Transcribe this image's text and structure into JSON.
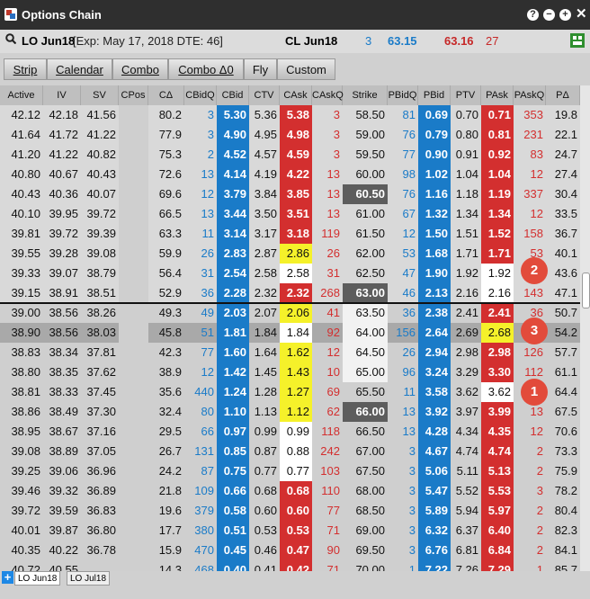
{
  "window": {
    "title": "Options Chain",
    "controls": [
      "?",
      "−",
      "+",
      "✕"
    ]
  },
  "info": {
    "symbol": "LO Jun18",
    "expiry": "[Exp: May 17, 2018 DTE: 46]",
    "underlying": "CL Jun18",
    "bid_size": "3",
    "bid": "63.15",
    "ask": "63.16",
    "ask_size": "27"
  },
  "tabs": [
    "Strip",
    "Calendar",
    "Combo",
    "Combo Δ0",
    "Fly",
    "Custom"
  ],
  "columns": [
    "Active",
    "IV",
    "SV",
    "CPos",
    "CΔ",
    "CBidQ",
    "CBid",
    "CTV",
    "CAsk",
    "CAskQ",
    "Strike",
    "PBidQ",
    "PBid",
    "PTV",
    "PAsk",
    "PAskQ",
    "PΔ"
  ],
  "rows": [
    [
      "42.12",
      "42.18",
      "41.56",
      "",
      "80.2",
      "3",
      "5.30",
      "5.36",
      "5.38",
      "3",
      "58.50",
      "81",
      "0.69",
      "0.70",
      "0.71",
      "353",
      "19.8"
    ],
    [
      "41.64",
      "41.72",
      "41.22",
      "",
      "77.9",
      "3",
      "4.90",
      "4.95",
      "4.98",
      "3",
      "59.00",
      "76",
      "0.79",
      "0.80",
      "0.81",
      "231",
      "22.1"
    ],
    [
      "41.20",
      "41.22",
      "40.82",
      "",
      "75.3",
      "2",
      "4.52",
      "4.57",
      "4.59",
      "3",
      "59.50",
      "77",
      "0.90",
      "0.91",
      "0.92",
      "83",
      "24.7"
    ],
    [
      "40.80",
      "40.67",
      "40.43",
      "",
      "72.6",
      "13",
      "4.14",
      "4.19",
      "4.22",
      "13",
      "60.00",
      "98",
      "1.02",
      "1.04",
      "1.04",
      "12",
      "27.4"
    ],
    [
      "40.43",
      "40.36",
      "40.07",
      "",
      "69.6",
      "12",
      "3.79",
      "3.84",
      "3.85",
      "13",
      "60.50",
      "76",
      "1.16",
      "1.18",
      "1.19",
      "337",
      "30.4"
    ],
    [
      "40.10",
      "39.95",
      "39.72",
      "",
      "66.5",
      "13",
      "3.44",
      "3.50",
      "3.51",
      "13",
      "61.00",
      "67",
      "1.32",
      "1.34",
      "1.34",
      "12",
      "33.5"
    ],
    [
      "39.81",
      "39.72",
      "39.39",
      "",
      "63.3",
      "11",
      "3.14",
      "3.17",
      "3.18",
      "119",
      "61.50",
      "12",
      "1.50",
      "1.51",
      "1.52",
      "158",
      "36.7"
    ],
    [
      "39.55",
      "39.28",
      "39.08",
      "",
      "59.9",
      "26",
      "2.83",
      "2.87",
      "2.86",
      "26",
      "62.00",
      "53",
      "1.68",
      "1.71",
      "1.71",
      "53",
      "40.1"
    ],
    [
      "39.33",
      "39.07",
      "38.79",
      "",
      "56.4",
      "31",
      "2.54",
      "2.58",
      "2.58",
      "31",
      "62.50",
      "47",
      "1.90",
      "1.92",
      "1.92",
      "",
      "43.6"
    ],
    [
      "39.15",
      "38.91",
      "38.51",
      "",
      "52.9",
      "36",
      "2.28",
      "2.32",
      "2.32",
      "268",
      "63.00",
      "46",
      "2.13",
      "2.16",
      "2.16",
      "143",
      "47.1"
    ],
    [
      "39.00",
      "38.56",
      "38.26",
      "",
      "49.3",
      "49",
      "2.03",
      "2.07",
      "2.06",
      "41",
      "63.50",
      "36",
      "2.38",
      "2.41",
      "2.41",
      "36",
      "50.7"
    ],
    [
      "38.90",
      "38.56",
      "38.03",
      "",
      "45.8",
      "51",
      "1.81",
      "1.84",
      "1.84",
      "92",
      "64.00",
      "156",
      "2.64",
      "2.69",
      "2.68",
      "",
      "54.2"
    ],
    [
      "38.83",
      "38.34",
      "37.81",
      "",
      "42.3",
      "77",
      "1.60",
      "1.64",
      "1.62",
      "12",
      "64.50",
      "26",
      "2.94",
      "2.98",
      "2.98",
      "126",
      "57.7"
    ],
    [
      "38.80",
      "38.35",
      "37.62",
      "",
      "38.9",
      "12",
      "1.42",
      "1.45",
      "1.43",
      "10",
      "65.00",
      "96",
      "3.24",
      "3.29",
      "3.30",
      "112",
      "61.1"
    ],
    [
      "38.81",
      "38.33",
      "37.45",
      "",
      "35.6",
      "440",
      "1.24",
      "1.28",
      "1.27",
      "69",
      "65.50",
      "11",
      "3.58",
      "3.62",
      "3.62",
      "",
      "64.4"
    ],
    [
      "38.86",
      "38.49",
      "37.30",
      "",
      "32.4",
      "80",
      "1.10",
      "1.13",
      "1.12",
      "62",
      "66.00",
      "13",
      "3.92",
      "3.97",
      "3.99",
      "13",
      "67.5"
    ],
    [
      "38.95",
      "38.67",
      "37.16",
      "",
      "29.5",
      "66",
      "0.97",
      "0.99",
      "0.99",
      "118",
      "66.50",
      "13",
      "4.28",
      "4.34",
      "4.35",
      "12",
      "70.6"
    ],
    [
      "39.08",
      "38.89",
      "37.05",
      "",
      "26.7",
      "131",
      "0.85",
      "0.87",
      "0.88",
      "242",
      "67.00",
      "3",
      "4.67",
      "4.74",
      "4.74",
      "2",
      "73.3"
    ],
    [
      "39.25",
      "39.06",
      "36.96",
      "",
      "24.2",
      "87",
      "0.75",
      "0.77",
      "0.77",
      "103",
      "67.50",
      "3",
      "5.06",
      "5.11",
      "5.13",
      "2",
      "75.9"
    ],
    [
      "39.46",
      "39.32",
      "36.89",
      "",
      "21.8",
      "109",
      "0.66",
      "0.68",
      "0.68",
      "110",
      "68.00",
      "3",
      "5.47",
      "5.52",
      "5.53",
      "3",
      "78.2"
    ],
    [
      "39.72",
      "39.59",
      "36.83",
      "",
      "19.6",
      "379",
      "0.58",
      "0.60",
      "0.60",
      "77",
      "68.50",
      "3",
      "5.89",
      "5.94",
      "5.97",
      "2",
      "80.4"
    ],
    [
      "40.01",
      "39.87",
      "36.80",
      "",
      "17.7",
      "380",
      "0.51",
      "0.53",
      "0.53",
      "71",
      "69.00",
      "3",
      "6.32",
      "6.37",
      "6.40",
      "2",
      "82.3"
    ],
    [
      "40.35",
      "40.22",
      "36.78",
      "",
      "15.9",
      "470",
      "0.45",
      "0.46",
      "0.47",
      "90",
      "69.50",
      "3",
      "6.76",
      "6.81",
      "6.84",
      "2",
      "84.1"
    ],
    [
      "40.72",
      "40.55",
      "",
      "",
      "14.3",
      "468",
      "0.40",
      "0.41",
      "0.42",
      "71",
      "70.00",
      "1",
      "7.22",
      "7.26",
      "7.29",
      "1",
      "85.7"
    ]
  ],
  "badges": [
    "2",
    "3",
    "1"
  ],
  "bottom_tabs": [
    "LO Jun18",
    "LO Jul18"
  ],
  "colors": {
    "bid": "#1a7bc8",
    "ask": "#d32f2f",
    "yellow": "#f5f12a",
    "strike_dark": "#5d5d5d"
  }
}
